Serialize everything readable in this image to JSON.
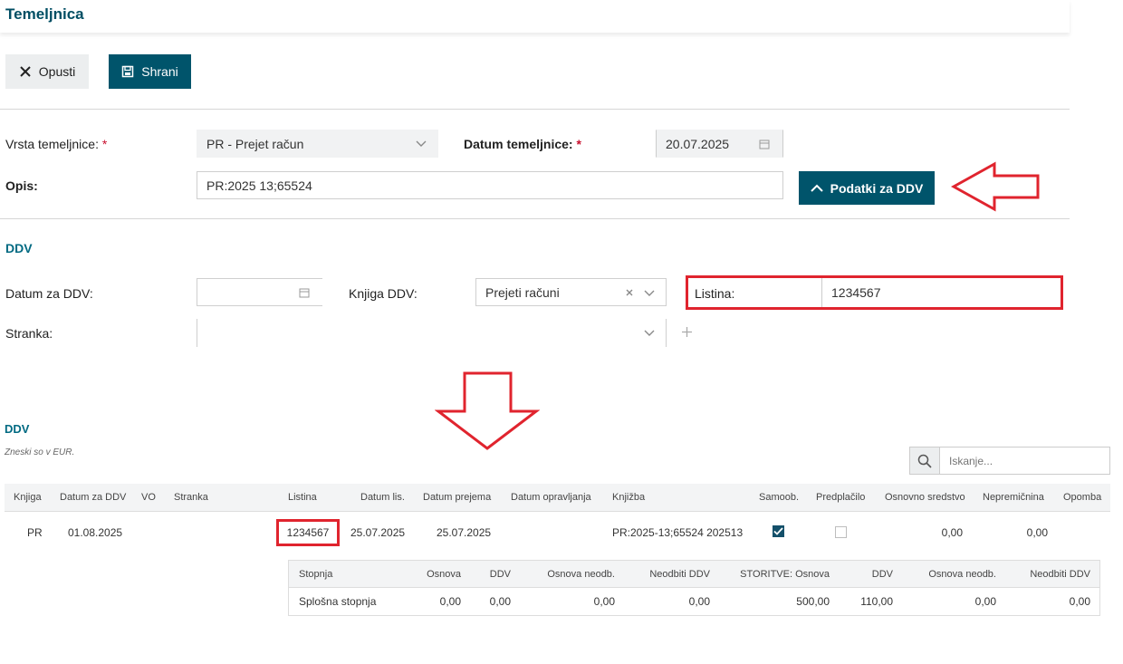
{
  "header": {
    "title": "Temeljnica"
  },
  "toolbar": {
    "cancel_label": "Opusti",
    "save_label": "Shrani"
  },
  "form": {
    "vrsta_label": "Vrsta temeljnice:",
    "vrsta_value": "PR - Prejet račun",
    "datum_label": "Datum temeljnice:",
    "datum_value": "20.07.2025",
    "opis_label": "Opis:",
    "opis_value": "PR:2025 13;65524",
    "ddv_button": "Podatki za DDV",
    "required_mark": "*"
  },
  "ddv_section": {
    "title": "DDV",
    "datum_label": "Datum za DDV:",
    "datum_value": "",
    "knjiga_label": "Knjiga DDV:",
    "knjiga_value": "Prejeti računi",
    "listina_label": "Listina:",
    "listina_value": "1234567",
    "stranka_label": "Stranka:",
    "stranka_value": ""
  },
  "ddv_table": {
    "title": "DDV",
    "note": "Zneski so v EUR.",
    "search_placeholder": "Iskanje...",
    "columns": [
      "Knjiga",
      "Datum za DDV",
      "VO",
      "Stranka",
      "Listina",
      "Datum lis.",
      "Datum prejema",
      "Datum opravljanja",
      "Knjižba",
      "Samoob.",
      "Predplačilo",
      "Osnovno sredstvo",
      "Nepremičnina",
      "Opomba"
    ],
    "row": {
      "knjiga": "PR",
      "datum_ddv": "01.08.2025",
      "listina": "1234567",
      "datum_lis": "25.07.2025",
      "datum_prejema": "25.07.2025",
      "knjizba": "PR:2025-13;65524 202513",
      "samoob": true,
      "predplacilo": false,
      "osnovno_sredstvo": "0,00",
      "nepremicnina": "0,00"
    },
    "sub_columns": [
      "Stopnja",
      "Osnova",
      "DDV",
      "Osnova neodb.",
      "Neodbiti DDV",
      "STORITVE: Osnova",
      "DDV",
      "Osnova neodb.",
      "Neodbiti DDV"
    ],
    "sub_row": [
      "Splošna stopnja",
      "0,00",
      "0,00",
      "0,00",
      "0,00",
      "500,00",
      "110,00",
      "0,00",
      "0,00"
    ]
  },
  "colors": {
    "brand": "#00546b",
    "highlight": "#e0242e"
  }
}
